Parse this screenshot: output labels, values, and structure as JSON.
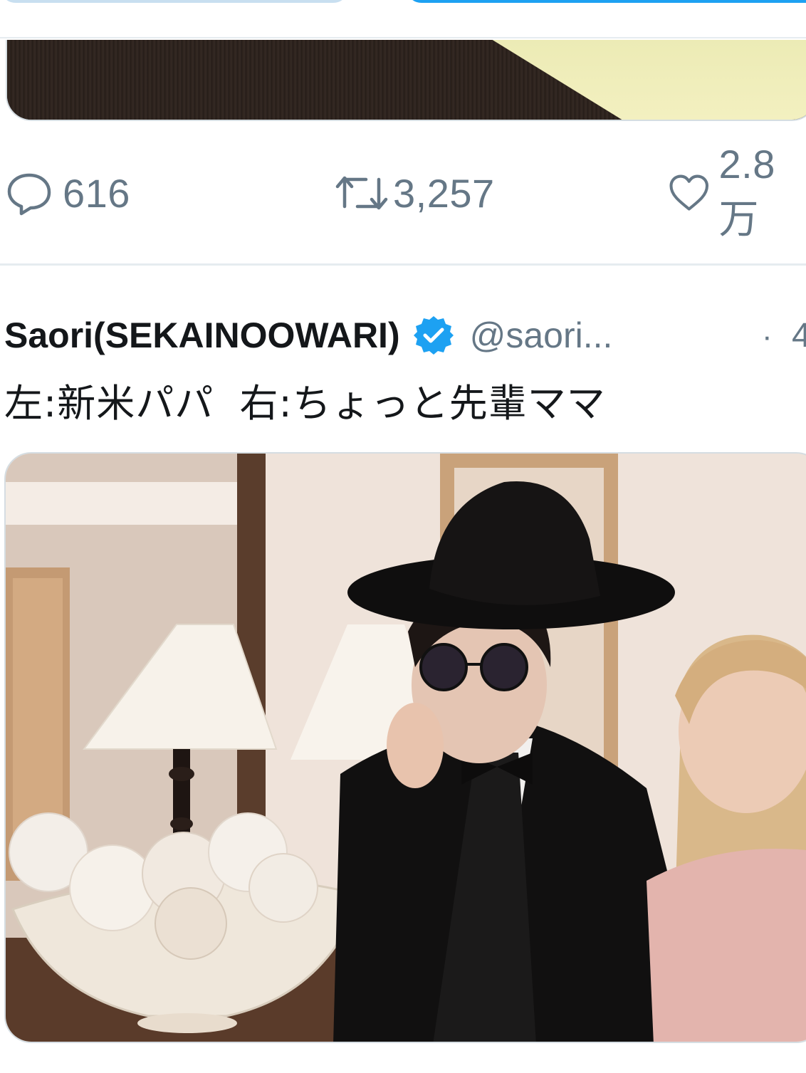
{
  "previous_tweet": {
    "actions": {
      "reply_count": "616",
      "retweet_count": "3,257",
      "like_count": "2.8万"
    }
  },
  "tweet": {
    "display_name": "Saori(SEKAINOOWARI)",
    "verified": true,
    "handle": "@saori...",
    "separator": "·",
    "time_fragment": "4",
    "text": "左:新米パパ  右:ちょっと先輩ママ",
    "photo": "photo of a man in a black wide-brim hat, sunglasses and black velvet suit with a woman with blonde bob hair in pink top, lamp and bowl of pearly spheres in background"
  },
  "colors": {
    "accent": "#1da1f2",
    "muted_text": "#657786",
    "divider": "#e6ecf0",
    "verified_badge": "#1da1f2"
  },
  "icons": {
    "reply": "reply-bubble-icon",
    "retweet": "retweet-icon",
    "like": "heart-icon",
    "verified": "verified-badge-icon"
  }
}
